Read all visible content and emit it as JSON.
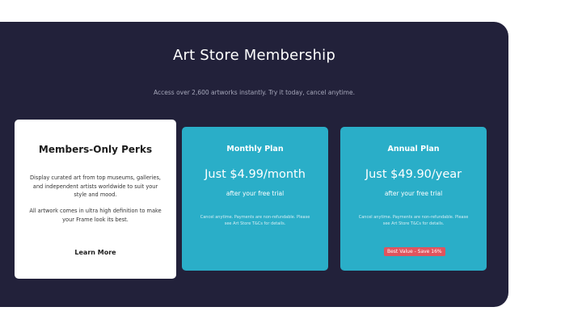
{
  "header": {
    "title": "Art Store Membership",
    "subtitle": "Access over 2,600 artworks instantly. Try it today, cancel anytime."
  },
  "perks": {
    "heading": "Members-Only Perks",
    "paragraph1": "Display curated art from top museums, galleries, and independent artists worldwide to suit your style and mood.",
    "paragraph2": "All artwork comes in ultra high definition to make your Frame look its best.",
    "learn_more": "Learn More"
  },
  "plans": [
    {
      "name": "Monthly Plan",
      "price": "Just $4.99/month",
      "after": "after your free trial",
      "fine_print": "Cancel anytime. Payments are non-refundable. Please see Art Store T&Cs for details."
    },
    {
      "name": "Annual Plan",
      "price": "Just $49.90/year",
      "after": "after your free trial",
      "fine_print": "Cancel anytime. Payments are non-refundable. Please see Art Store T&Cs for details.",
      "badge": "Best Value - Save 16%"
    }
  ],
  "colors": {
    "background": "#22213a",
    "plan_card": "#2aaec8",
    "badge": "#e0545e"
  }
}
